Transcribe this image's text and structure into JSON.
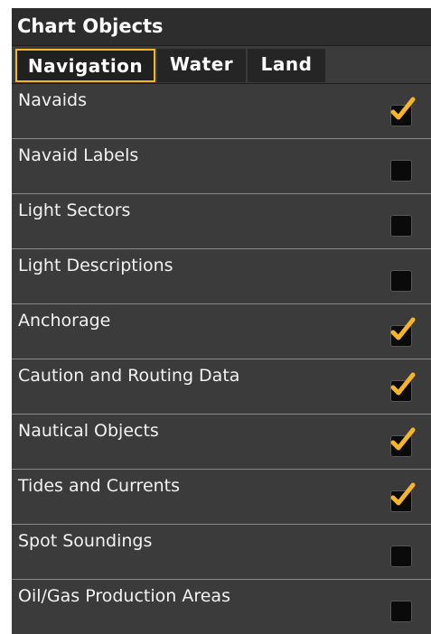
{
  "title": "Chart Objects",
  "tabs": [
    {
      "label": "Navigation",
      "active": true
    },
    {
      "label": "Water",
      "active": false
    },
    {
      "label": "Land",
      "active": false
    }
  ],
  "items": [
    {
      "label": "Navaids",
      "checked": true
    },
    {
      "label": "Navaid Labels",
      "checked": false
    },
    {
      "label": "Light Sectors",
      "checked": false
    },
    {
      "label": "Light Descriptions",
      "checked": false
    },
    {
      "label": "Anchorage",
      "checked": true
    },
    {
      "label": "Caution and Routing Data",
      "checked": true
    },
    {
      "label": "Nautical Objects",
      "checked": true
    },
    {
      "label": "Tides and Currents",
      "checked": true
    },
    {
      "label": "Spot Soundings",
      "checked": false
    },
    {
      "label": "Oil/Gas Production Areas",
      "checked": false
    }
  ],
  "colors": {
    "accent": "#f5b526",
    "panel": "#3b3b3b",
    "title_bar": "#2d2d2d",
    "checkbox": "#0a0a0a"
  }
}
